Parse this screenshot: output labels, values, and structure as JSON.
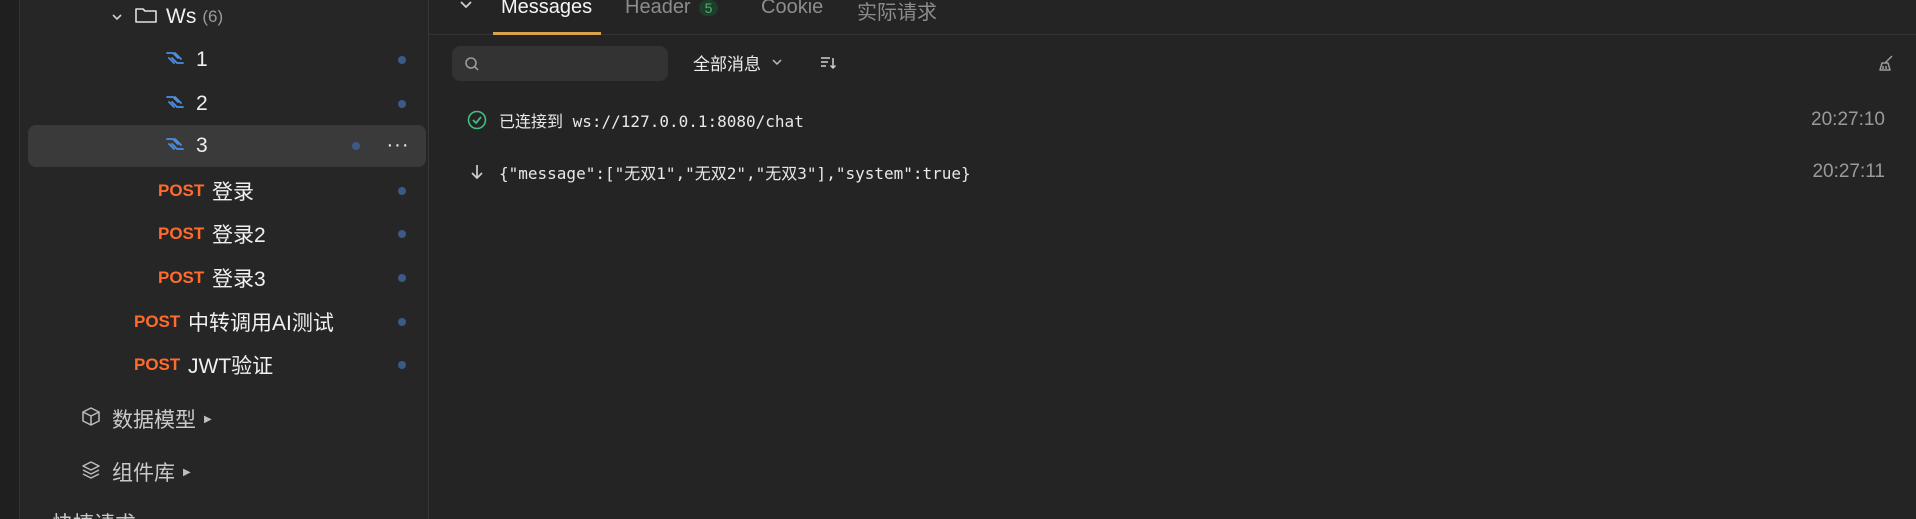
{
  "tree": {
    "folder": {
      "name": "Ws",
      "count": "(6)"
    },
    "ws_items": [
      {
        "label": "1"
      },
      {
        "label": "2"
      },
      {
        "label": "3"
      }
    ],
    "requests": [
      {
        "method": "POST",
        "label": "登录"
      },
      {
        "method": "POST",
        "label": "登录2"
      },
      {
        "method": "POST",
        "label": "登录3"
      },
      {
        "method": "POST",
        "label": "中转调用AI测试"
      },
      {
        "method": "POST",
        "label": "JWT验证"
      }
    ],
    "more_label": "···",
    "sections": [
      {
        "label": "数据模型"
      },
      {
        "label": "组件库"
      },
      {
        "label": "快捷请求"
      }
    ]
  },
  "tabs": {
    "messages": "Messages",
    "header": "Header",
    "header_count": "5",
    "cookie": "Cookie",
    "actual_request": "实际请求"
  },
  "toolbar": {
    "search_placeholder": "",
    "filter_label": "全部消息"
  },
  "messages": [
    {
      "icon": "connected-check-icon",
      "text": "已连接到 ws://127.0.0.1:8080/chat",
      "time": "20:27:10"
    },
    {
      "icon": "received-arrow-down-icon",
      "text": "{\"message\":[\"无双1\",\"无双2\",\"无双3\"],\"system\":true}",
      "time": "20:27:11"
    }
  ],
  "colors": {
    "method_post": "#ff6b2c",
    "accent_tab": "#d9a24c",
    "ws_icon": "#4a90e2",
    "success": "#3fbf7f"
  }
}
